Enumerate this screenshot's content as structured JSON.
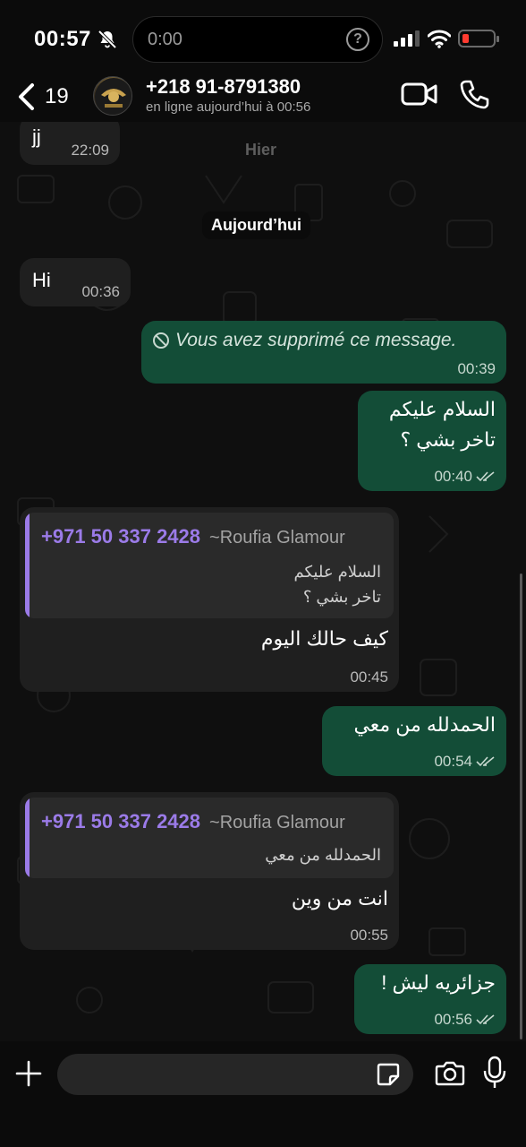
{
  "status_bar": {
    "time": "00:57",
    "island_time": "0:00",
    "island_icon": "?",
    "battery_level": 0.2,
    "battery_color": "#ff3b30"
  },
  "header": {
    "back_count": "19",
    "contact_name": "+218 91-8791380",
    "contact_status": "en ligne aujourd’hui à 00:56"
  },
  "chat": {
    "messages": [
      {
        "direction": "in",
        "text": "jj",
        "time": "22:09"
      },
      {
        "direction": "date",
        "text": "Hier"
      },
      {
        "direction": "date",
        "text": "Aujourd’hui"
      },
      {
        "direction": "in",
        "text": "Hi",
        "time": "00:36"
      },
      {
        "direction": "out",
        "text": "Vous avez supprimé ce message.",
        "time": "00:39",
        "deleted": true
      },
      {
        "direction": "out",
        "line1": "السلام عليكم",
        "line2": "تاخر بشي ؟",
        "time": "00:40",
        "read": true
      },
      {
        "direction": "in",
        "reply": {
          "phone": "+971 50 337 2428",
          "name": "~Roufia Glamour",
          "line1": "السلام عليكم",
          "line2": "تاخر بشي ؟"
        },
        "text": "كيف حالك اليوم",
        "time": "00:45"
      },
      {
        "direction": "out",
        "text": "الحمدلله من معي",
        "time": "00:54",
        "read": true
      },
      {
        "direction": "in",
        "reply": {
          "phone": "+971 50 337 2428",
          "name": "~Roufia Glamour",
          "line1": "الحمدلله من معي"
        },
        "text": "انت من وين",
        "time": "00:55"
      },
      {
        "direction": "out",
        "text": "جزائريه ليش !",
        "time": "00:56",
        "read": true
      }
    ]
  },
  "composer": {
    "placeholder": ""
  },
  "colors": {
    "outgoing_bubble": "#134d37",
    "incoming_bubble": "#1f1f1f",
    "reply_accent": "#9b7be8"
  },
  "icons": [
    "bell-slash-icon",
    "question-icon",
    "signal-icon",
    "wifi-icon",
    "battery-icon",
    "chevron-left-icon",
    "video-icon",
    "phone-icon",
    "block-icon",
    "double-check-icon",
    "plus-icon",
    "sticker-icon",
    "camera-icon",
    "mic-icon"
  ]
}
